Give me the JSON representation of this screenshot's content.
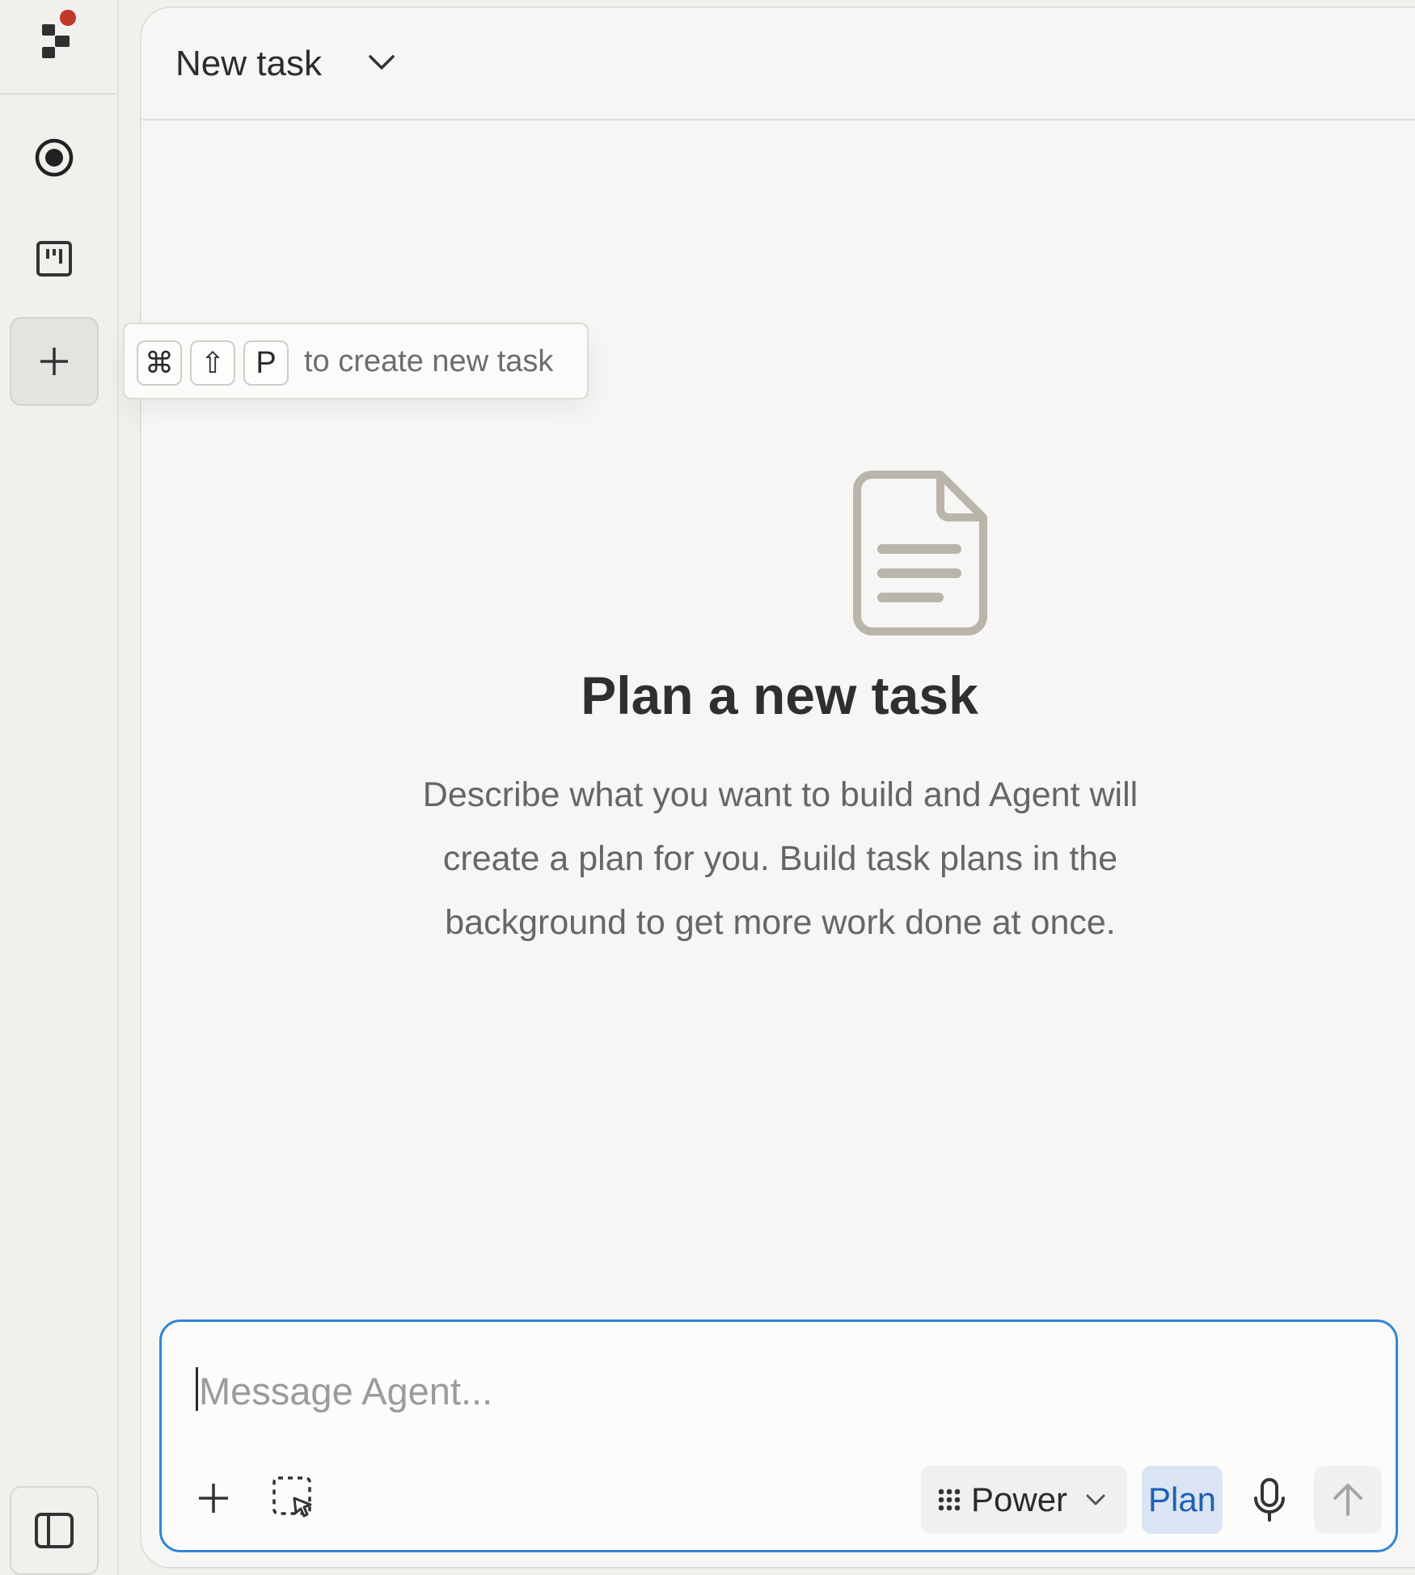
{
  "header": {
    "title": "New task"
  },
  "tooltip": {
    "keys": [
      "⌘",
      "⇧",
      "P"
    ],
    "text": "to create new task"
  },
  "empty_state": {
    "title": "Plan a new task",
    "description": "Describe what you want to build and Agent will create a plan for you. Build task plans in the background to get more work done at once."
  },
  "composer": {
    "placeholder": "Message Agent...",
    "mode_label": "Power",
    "plan_label": "Plan"
  },
  "icons": {
    "logo": "app-logo",
    "notification_dot": "#c0392b",
    "rail": [
      "target-icon",
      "board-icon",
      "plus-icon",
      "sidebar-toggle-icon"
    ],
    "composer": [
      "plus-icon",
      "select-region-icon",
      "grid-dots-icon",
      "chevron-down-icon",
      "microphone-icon",
      "arrow-up-icon"
    ]
  },
  "colors": {
    "accent_border": "#2f86d6",
    "plan_bg": "#dae4f3",
    "plan_text": "#1f5fb3",
    "doc_icon": "#bab5aa"
  }
}
